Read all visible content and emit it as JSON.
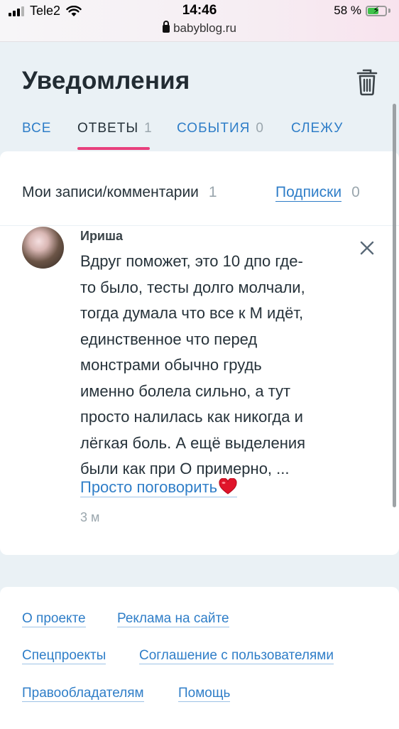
{
  "status_bar": {
    "carrier": "Tele2",
    "time": "14:46",
    "battery_percent": "58 %",
    "battery_level": 0.58,
    "signal_icon": "signal-icon",
    "wifi_icon": "wifi-icon",
    "battery_icon": "battery-charging-icon"
  },
  "browser": {
    "url": "babyblog.ru",
    "lock_icon": "lock-icon"
  },
  "header": {
    "title": "Уведомления",
    "trash_icon": "trash-icon"
  },
  "tabs": [
    {
      "label": "ВСЕ",
      "count": "",
      "active": false
    },
    {
      "label": "ОТВЕТЫ",
      "count": "1",
      "active": true
    },
    {
      "label": "СОБЫТИЯ",
      "count": "0",
      "active": false
    },
    {
      "label": "СЛЕЖУ",
      "count": "",
      "active": false
    }
  ],
  "filters": {
    "left_label": "Мои записи/комментарии",
    "left_count": "1",
    "right_label": "Подписки",
    "right_count": "0"
  },
  "notification": {
    "author": "Ириша",
    "message_lines": [
      "Вдруг поможет, это 10 дпо где-",
      "то было, тесты долго молчали,",
      "тогда думала что все к М идёт,",
      "единственное что перед",
      "монстрами обычно грудь",
      "именно болела сильно, а тут",
      "просто налилась как никогда и",
      "лёгкая боль. А ещё выделения",
      "были как при О примерно, ..."
    ],
    "thread_link": "Просто поговорить",
    "thread_icon": "heart-icon",
    "time_ago": "3 м",
    "close_icon": "close-icon"
  },
  "footer": {
    "links": [
      "О проекте",
      "Реклама на сайте",
      "Спецпроекты",
      "Соглашение с пользователями",
      "Правообладателям",
      "Помощь"
    ]
  },
  "colors": {
    "accent_blue": "#2f7ec8",
    "active_tab_underline": "#e8407d",
    "page_background": "#eaf1f5",
    "muted_count": "#9aa6ad"
  }
}
